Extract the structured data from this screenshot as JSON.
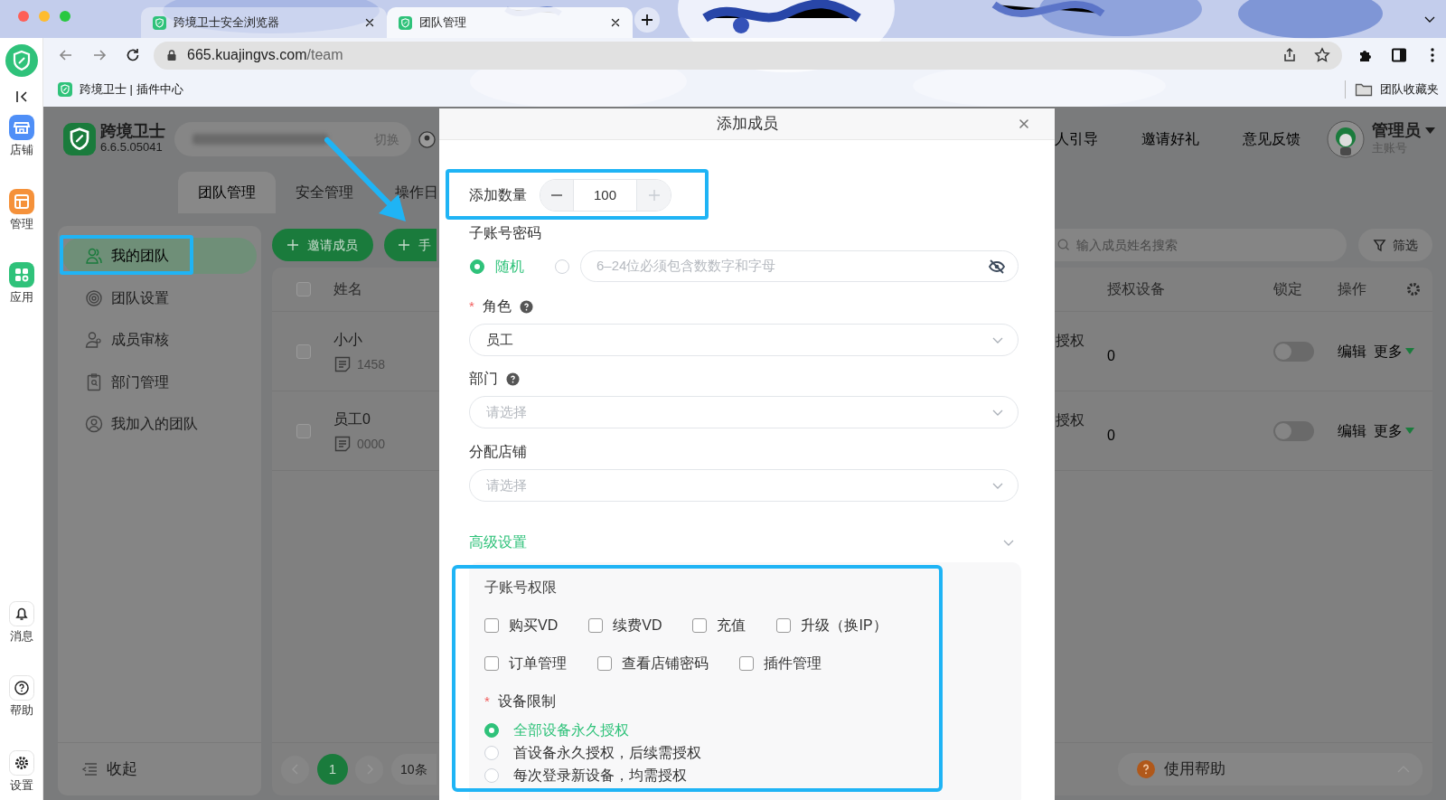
{
  "browser": {
    "tabs": [
      {
        "title": "跨境卫士安全浏览器",
        "selected": false
      },
      {
        "title": "团队管理",
        "selected": true
      }
    ],
    "url_host": "665.kuajingvs.com",
    "url_path": "/team",
    "bookmarks": [
      {
        "label": "跨境卫士 | 插件中心"
      }
    ],
    "bookmark_folder": "团队收藏夹"
  },
  "rail": {
    "top": [
      {
        "label": "店铺",
        "kind": "store"
      },
      {
        "label": "管理",
        "kind": "manage"
      },
      {
        "label": "应用",
        "kind": "apps"
      }
    ],
    "bottom": [
      {
        "label": "消息",
        "kind": "bell"
      },
      {
        "label": "帮助",
        "kind": "help"
      },
      {
        "label": "设置",
        "kind": "gear"
      }
    ]
  },
  "app": {
    "name": "跨境卫士",
    "version": "6.6.5.05041",
    "switch": "切换",
    "nav": [
      "人引导",
      "邀请好礼",
      "意见反馈"
    ],
    "user": {
      "name": "管理员",
      "role": "主账号"
    }
  },
  "tabs": [
    {
      "label": "团队管理",
      "selected": true
    },
    {
      "label": "安全管理",
      "selected": false
    },
    {
      "label": "操作日",
      "selected": false
    }
  ],
  "sidebar": {
    "items": [
      {
        "label": "我的团队",
        "kind": "team",
        "selected": true
      },
      {
        "label": "团队设置",
        "kind": "settings",
        "selected": false
      },
      {
        "label": "成员审核",
        "kind": "review",
        "selected": false
      },
      {
        "label": "部门管理",
        "kind": "department",
        "selected": false
      },
      {
        "label": "我加入的团队",
        "kind": "joined",
        "selected": false
      }
    ],
    "collapse": "收起"
  },
  "toolbar": {
    "buttons": [
      {
        "label": "邀请成员"
      },
      {
        "label": "手"
      }
    ],
    "search_placeholder": "输入成员姓名搜索",
    "filter": "筛选"
  },
  "table": {
    "select_all": false,
    "columns": [
      "姓名",
      "授权设备",
      "锁定",
      "操作"
    ],
    "rows": [
      {
        "checked": false,
        "name": "小小",
        "note": "1458",
        "column_3": "授权",
        "devices": "0",
        "locked": false,
        "actions": [
          "编辑",
          "更多"
        ]
      },
      {
        "checked": false,
        "name": "员工0",
        "note": "0000",
        "column_3": "授权",
        "devices": "0",
        "locked": false,
        "actions": [
          "编辑",
          "更多"
        ]
      }
    ]
  },
  "pagination": {
    "pages": [
      {
        "label": "1",
        "selected": true
      }
    ],
    "page_size": "10条"
  },
  "help": "使用帮助",
  "modal": {
    "title": "添加成员",
    "quantity": {
      "label": "添加数量",
      "value": "100",
      "increment_disabled": true
    },
    "password": {
      "label": "子账号密码",
      "random": {
        "label": "随机",
        "selected": true
      },
      "custom": {
        "selected": false,
        "placeholder": "6–24位必须包含数数字和字母"
      }
    },
    "role": {
      "label": "角色",
      "mark": "*",
      "hint": true,
      "value": "员工"
    },
    "department": {
      "label": "部门",
      "hint": true,
      "placeholder": "请选择"
    },
    "stores": {
      "label": "分配店铺",
      "placeholder": "请选择"
    },
    "advanced": {
      "label": "高级设置"
    },
    "permissions": {
      "label": "子账号权限",
      "rows": [
        {
          "items": [
            {
              "label": "购买VD",
              "checked": false
            },
            {
              "label": "续费VD",
              "checked": false
            },
            {
              "label": "充值",
              "checked": false
            },
            {
              "label": "升级（换IP）",
              "checked": false
            }
          ]
        },
        {
          "items": [
            {
              "label": "订单管理",
              "checked": false
            },
            {
              "label": "查看店铺密码",
              "checked": false
            },
            {
              "label": "插件管理",
              "checked": false
            }
          ]
        }
      ]
    },
    "device_limit": {
      "label": "设备限制",
      "mark": "*",
      "options": [
        {
          "label": "全部设备永久授权",
          "selected": true
        },
        {
          "label": "首设备永久授权，后续需授权",
          "selected": false
        },
        {
          "label": "每次登录新设备，均需授权",
          "selected": false
        }
      ]
    }
  }
}
